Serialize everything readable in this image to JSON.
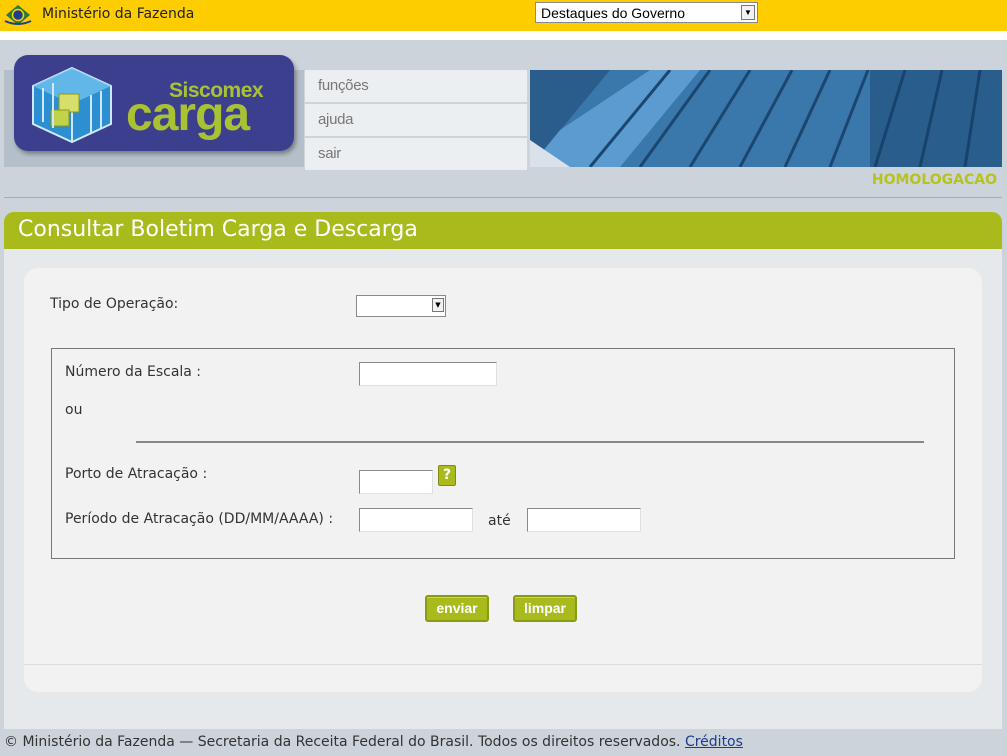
{
  "gov_bar": {
    "title": "Ministério da Fazenda",
    "destaques_select": "Destaques do Governo",
    "emblem_icon": "brazil-coat-of-arms-icon"
  },
  "header": {
    "logo_top": "Siscomex",
    "logo_main": "Carga",
    "menu": [
      "funções",
      "ajuda",
      "sair"
    ],
    "environment": "HOMOLOGACAO"
  },
  "panel": {
    "title": "Consultar Boletim Carga e Descarga"
  },
  "form": {
    "tipo_operacao_label": "Tipo de Operação:",
    "tipo_operacao_value": "",
    "numero_escala_label": "Número da Escala :",
    "numero_escala_value": "",
    "ou_label": "ou",
    "porto_label": "Porto de Atracação :",
    "porto_value": "",
    "help_label": "?",
    "periodo_label": "Período de Atracação (DD/MM/AAAA) :",
    "periodo_de_value": "",
    "ate_label": "até",
    "periodo_ate_value": "",
    "enviar_label": "enviar",
    "limpar_label": "limpar"
  },
  "footer": {
    "text": "© Ministério da Fazenda — Secretaria da Receita Federal do Brasil. Todos os direitos reservados.",
    "link": "Créditos"
  },
  "colors": {
    "gov_yellow": "#fdcd00",
    "accent_green": "#a9bb1c",
    "logo_blue": "#3c3f8e",
    "page_bg": "#cdd3db"
  }
}
